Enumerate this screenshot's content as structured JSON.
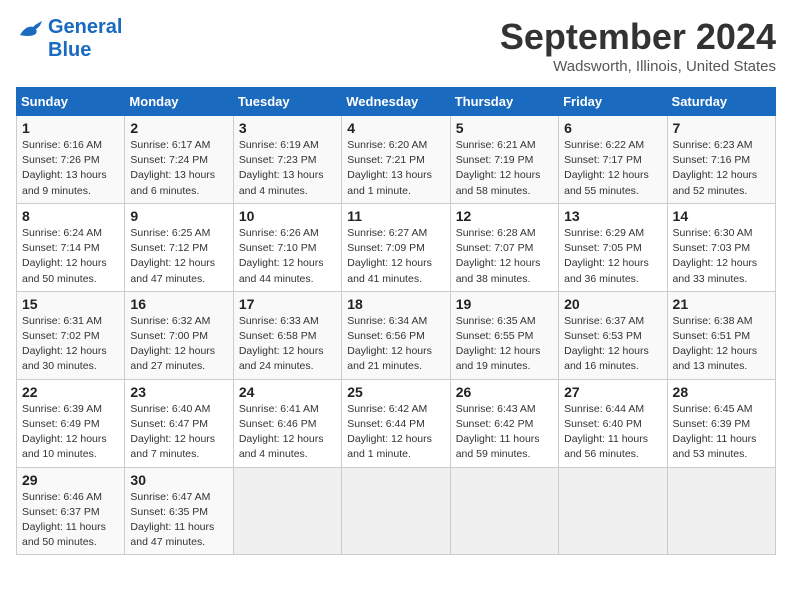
{
  "header": {
    "logo_line1": "General",
    "logo_line2": "Blue",
    "main_title": "September 2024",
    "subtitle": "Wadsworth, Illinois, United States"
  },
  "days_of_week": [
    "Sunday",
    "Monday",
    "Tuesday",
    "Wednesday",
    "Thursday",
    "Friday",
    "Saturday"
  ],
  "weeks": [
    [
      {
        "day": "1",
        "info": "Sunrise: 6:16 AM\nSunset: 7:26 PM\nDaylight: 13 hours\nand 9 minutes."
      },
      {
        "day": "2",
        "info": "Sunrise: 6:17 AM\nSunset: 7:24 PM\nDaylight: 13 hours\nand 6 minutes."
      },
      {
        "day": "3",
        "info": "Sunrise: 6:19 AM\nSunset: 7:23 PM\nDaylight: 13 hours\nand 4 minutes."
      },
      {
        "day": "4",
        "info": "Sunrise: 6:20 AM\nSunset: 7:21 PM\nDaylight: 13 hours\nand 1 minute."
      },
      {
        "day": "5",
        "info": "Sunrise: 6:21 AM\nSunset: 7:19 PM\nDaylight: 12 hours\nand 58 minutes."
      },
      {
        "day": "6",
        "info": "Sunrise: 6:22 AM\nSunset: 7:17 PM\nDaylight: 12 hours\nand 55 minutes."
      },
      {
        "day": "7",
        "info": "Sunrise: 6:23 AM\nSunset: 7:16 PM\nDaylight: 12 hours\nand 52 minutes."
      }
    ],
    [
      {
        "day": "8",
        "info": "Sunrise: 6:24 AM\nSunset: 7:14 PM\nDaylight: 12 hours\nand 50 minutes."
      },
      {
        "day": "9",
        "info": "Sunrise: 6:25 AM\nSunset: 7:12 PM\nDaylight: 12 hours\nand 47 minutes."
      },
      {
        "day": "10",
        "info": "Sunrise: 6:26 AM\nSunset: 7:10 PM\nDaylight: 12 hours\nand 44 minutes."
      },
      {
        "day": "11",
        "info": "Sunrise: 6:27 AM\nSunset: 7:09 PM\nDaylight: 12 hours\nand 41 minutes."
      },
      {
        "day": "12",
        "info": "Sunrise: 6:28 AM\nSunset: 7:07 PM\nDaylight: 12 hours\nand 38 minutes."
      },
      {
        "day": "13",
        "info": "Sunrise: 6:29 AM\nSunset: 7:05 PM\nDaylight: 12 hours\nand 36 minutes."
      },
      {
        "day": "14",
        "info": "Sunrise: 6:30 AM\nSunset: 7:03 PM\nDaylight: 12 hours\nand 33 minutes."
      }
    ],
    [
      {
        "day": "15",
        "info": "Sunrise: 6:31 AM\nSunset: 7:02 PM\nDaylight: 12 hours\nand 30 minutes."
      },
      {
        "day": "16",
        "info": "Sunrise: 6:32 AM\nSunset: 7:00 PM\nDaylight: 12 hours\nand 27 minutes."
      },
      {
        "day": "17",
        "info": "Sunrise: 6:33 AM\nSunset: 6:58 PM\nDaylight: 12 hours\nand 24 minutes."
      },
      {
        "day": "18",
        "info": "Sunrise: 6:34 AM\nSunset: 6:56 PM\nDaylight: 12 hours\nand 21 minutes."
      },
      {
        "day": "19",
        "info": "Sunrise: 6:35 AM\nSunset: 6:55 PM\nDaylight: 12 hours\nand 19 minutes."
      },
      {
        "day": "20",
        "info": "Sunrise: 6:37 AM\nSunset: 6:53 PM\nDaylight: 12 hours\nand 16 minutes."
      },
      {
        "day": "21",
        "info": "Sunrise: 6:38 AM\nSunset: 6:51 PM\nDaylight: 12 hours\nand 13 minutes."
      }
    ],
    [
      {
        "day": "22",
        "info": "Sunrise: 6:39 AM\nSunset: 6:49 PM\nDaylight: 12 hours\nand 10 minutes."
      },
      {
        "day": "23",
        "info": "Sunrise: 6:40 AM\nSunset: 6:47 PM\nDaylight: 12 hours\nand 7 minutes."
      },
      {
        "day": "24",
        "info": "Sunrise: 6:41 AM\nSunset: 6:46 PM\nDaylight: 12 hours\nand 4 minutes."
      },
      {
        "day": "25",
        "info": "Sunrise: 6:42 AM\nSunset: 6:44 PM\nDaylight: 12 hours\nand 1 minute."
      },
      {
        "day": "26",
        "info": "Sunrise: 6:43 AM\nSunset: 6:42 PM\nDaylight: 11 hours\nand 59 minutes."
      },
      {
        "day": "27",
        "info": "Sunrise: 6:44 AM\nSunset: 6:40 PM\nDaylight: 11 hours\nand 56 minutes."
      },
      {
        "day": "28",
        "info": "Sunrise: 6:45 AM\nSunset: 6:39 PM\nDaylight: 11 hours\nand 53 minutes."
      }
    ],
    [
      {
        "day": "29",
        "info": "Sunrise: 6:46 AM\nSunset: 6:37 PM\nDaylight: 11 hours\nand 50 minutes."
      },
      {
        "day": "30",
        "info": "Sunrise: 6:47 AM\nSunset: 6:35 PM\nDaylight: 11 hours\nand 47 minutes."
      },
      {
        "day": "",
        "info": ""
      },
      {
        "day": "",
        "info": ""
      },
      {
        "day": "",
        "info": ""
      },
      {
        "day": "",
        "info": ""
      },
      {
        "day": "",
        "info": ""
      }
    ]
  ]
}
